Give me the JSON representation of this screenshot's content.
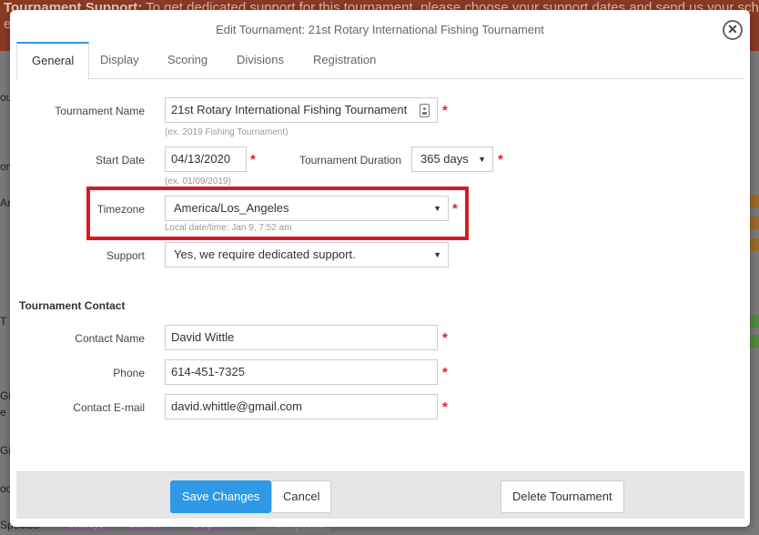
{
  "background": {
    "banner_bold": "Tournament Support:",
    "banner_text": " To get dedicated support for this tournament, please choose your support dates and send us your schedu",
    "banner_line2": "er",
    "fragments": [
      "ou",
      "on",
      "Ar",
      "T",
      "Gi",
      "e",
      "Gi",
      "oo",
      "Species"
    ],
    "tags": [
      "Walleye",
      "Salmon",
      "Dolphin",
      "+ Add species"
    ]
  },
  "modal": {
    "title": "Edit Tournament: 21st Rotary International Fishing Tournament",
    "close_glyph": "✕",
    "tabs": [
      "General",
      "Display",
      "Scoring",
      "Divisions",
      "Registration"
    ],
    "active_tab": "General"
  },
  "form": {
    "tournament_name": {
      "label": "Tournament Name",
      "value": "21st Rotary International Fishing Tournament",
      "hint": "(ex. 2019 Fishing Tournament)"
    },
    "start_date": {
      "label": "Start Date",
      "value": "04/13/2020",
      "hint": "(ex. 01/09/2019)"
    },
    "duration": {
      "label": "Tournament Duration",
      "value": "365 days"
    },
    "timezone": {
      "label": "Timezone",
      "value": "America/Los_Angeles",
      "hint": "Local date/time: Jan 9, 7:52 am"
    },
    "support": {
      "label": "Support",
      "value": "Yes, we require dedicated support."
    },
    "required_mark": "*",
    "caret": "▼"
  },
  "contact": {
    "section_title": "Tournament Contact",
    "name": {
      "label": "Contact Name",
      "value": "David Wittle"
    },
    "phone": {
      "label": "Phone",
      "value": "614-451-7325"
    },
    "email": {
      "label": "Contact E-mail",
      "value": "david.whittle@gmail.com"
    }
  },
  "footer": {
    "save": "Save Changes",
    "cancel": "Cancel",
    "delete": "Delete Tournament"
  },
  "colors": {
    "primary": "#2e99e6",
    "required": "#d9242f",
    "highlight": "#d71a21",
    "banner": "#8a3a24"
  }
}
